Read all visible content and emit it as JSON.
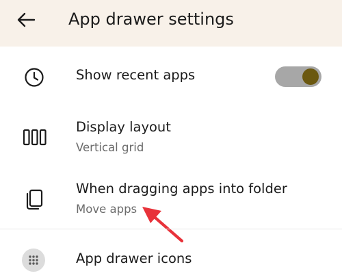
{
  "header": {
    "title": "App drawer settings",
    "back_icon": "arrow-left-icon"
  },
  "settings": {
    "recent_apps": {
      "title": "Show recent apps",
      "icon": "clock-icon",
      "toggle_on": true,
      "toggle_color": "#6b5810"
    },
    "display_layout": {
      "title": "Display layout",
      "subtitle": "Vertical grid",
      "icon": "columns-icon"
    },
    "drag_into_folder": {
      "title": "When dragging apps into folder",
      "subtitle": "Move apps",
      "icon": "copy-icon"
    },
    "drawer_icons": {
      "title": "App drawer icons",
      "icon": "grid-dots-icon"
    }
  },
  "colors": {
    "header_bg": "#f8f1e9",
    "annotation": "#e8323a"
  }
}
